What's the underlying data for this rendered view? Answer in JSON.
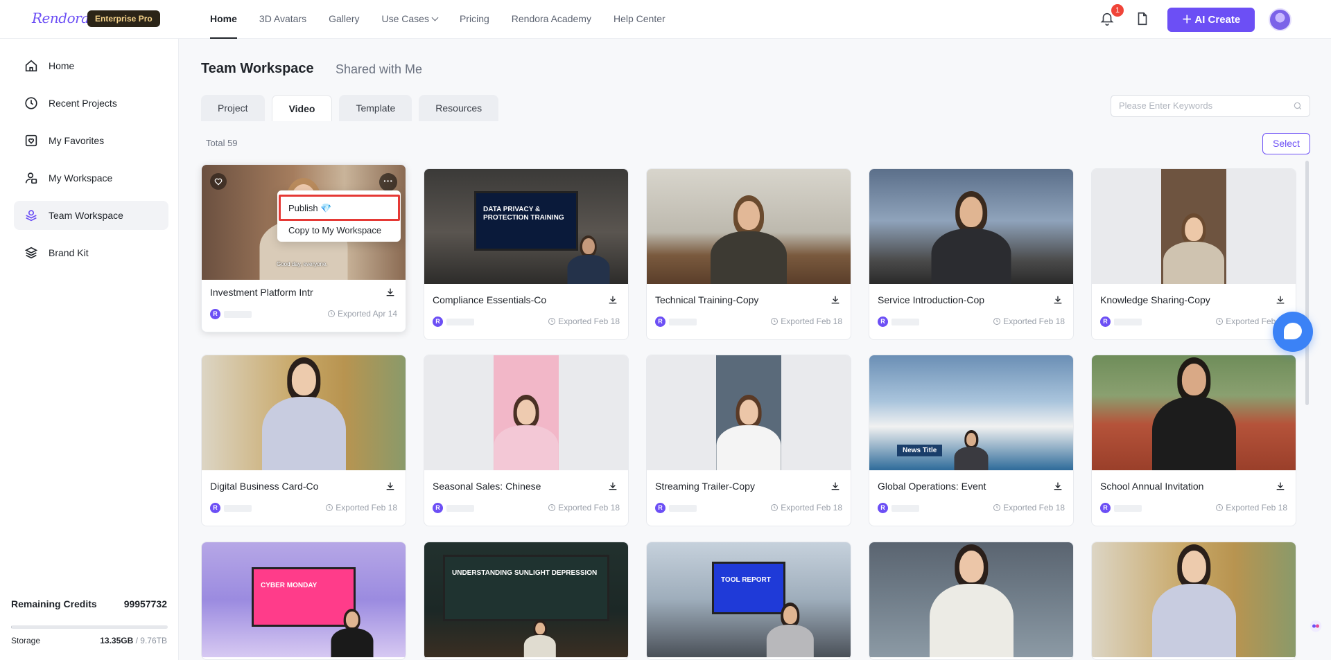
{
  "brand": {
    "logo_text": "Rendora",
    "plan_badge": "Enterprise Pro"
  },
  "nav": {
    "items": [
      "Home",
      "3D Avatars",
      "Gallery",
      "Use Cases",
      "Pricing",
      "Rendora Academy",
      "Help Center"
    ],
    "active": "Home",
    "notification_count": "1",
    "ai_create_label": "AI Create"
  },
  "sidebar": {
    "items": [
      {
        "label": "Home",
        "icon": "home-icon"
      },
      {
        "label": "Recent Projects",
        "icon": "clock-icon"
      },
      {
        "label": "My Favorites",
        "icon": "favorites-icon"
      },
      {
        "label": "My Workspace",
        "icon": "workspace-icon"
      },
      {
        "label": "Team Workspace",
        "icon": "team-workspace-icon"
      },
      {
        "label": "Brand Kit",
        "icon": "layers-icon"
      }
    ],
    "active": "Team Workspace",
    "credits_label": "Remaining Credits",
    "credits_value": "99957732",
    "storage_label": "Storage",
    "storage_used": "13.35GB",
    "storage_sep": " / ",
    "storage_total": "9.76TB"
  },
  "main": {
    "title": "Team Workspace",
    "alt_title": "Shared with Me",
    "tabs": [
      "Project",
      "Video",
      "Template",
      "Resources"
    ],
    "active_tab": "Video",
    "search_placeholder": "Please Enter Keywords",
    "total_text": "Total 59",
    "select_label": "Select"
  },
  "context_menu": {
    "items": [
      "Publish 💎",
      "Copy to My Workspace"
    ]
  },
  "videos": [
    {
      "title": "Investment Platform Intr",
      "exported": "Exported Apr 14",
      "subtitle_text": "Good day, everyone."
    },
    {
      "title": "Compliance Essentials-Co",
      "exported": "Exported Feb 18",
      "screen_text": "DATA PRIVACY & PROTECTION TRAINING"
    },
    {
      "title": "Technical Training-Copy",
      "exported": "Exported Feb 18"
    },
    {
      "title": "Service Introduction-Cop",
      "exported": "Exported Feb 18"
    },
    {
      "title": "Knowledge Sharing-Copy",
      "exported": "Exported Feb 18"
    },
    {
      "title": "Digital Business Card-Co",
      "exported": "Exported Feb 18"
    },
    {
      "title": "Seasonal Sales: Chinese",
      "exported": "Exported Feb 18"
    },
    {
      "title": "Streaming Trailer-Copy",
      "exported": "Exported Feb 18"
    },
    {
      "title": "Global Operations: Event",
      "exported": "Exported Feb 18",
      "screen_text": "News Title"
    },
    {
      "title": "School Annual Invitation",
      "exported": "Exported Feb 18"
    },
    {
      "title": "",
      "exported": "",
      "screen_text": "CYBER MONDAY"
    },
    {
      "title": "",
      "exported": "",
      "screen_text": "UNDERSTANDING SUNLIGHT DEPRESSION"
    },
    {
      "title": "",
      "exported": "",
      "screen_text": "TOOL REPORT"
    },
    {
      "title": "",
      "exported": ""
    },
    {
      "title": "",
      "exported": ""
    }
  ],
  "colors": {
    "accent": "#6c4ff5",
    "highlight": "#e53935",
    "chat": "#3b82f6"
  }
}
